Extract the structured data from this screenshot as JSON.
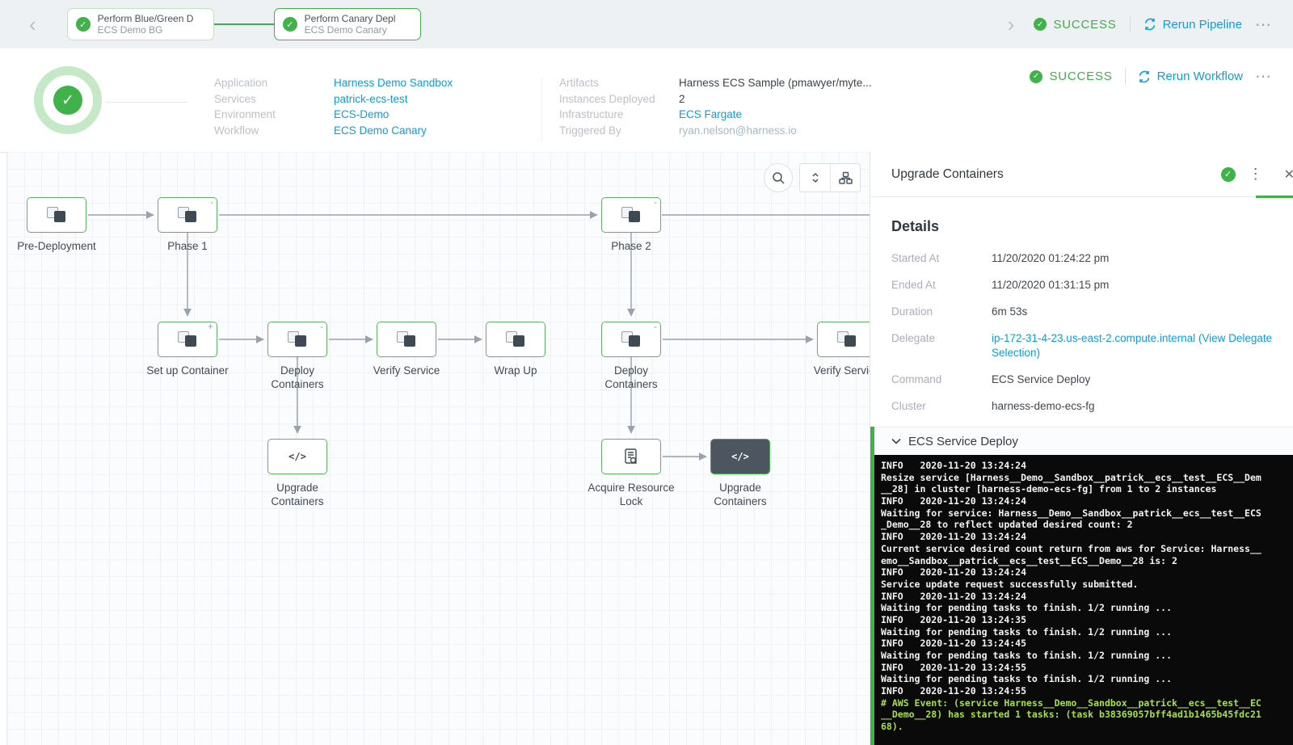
{
  "colors": {
    "accent_green": "#3fb24a",
    "link_blue": "#0a9fe0",
    "log_green": "#a8e03f"
  },
  "top_bar": {
    "stages": [
      {
        "title": "Perform Blue/Green D",
        "subtitle": "ECS Demo BG"
      },
      {
        "title": "Perform Canary Depl",
        "subtitle": "ECS Demo Canary"
      }
    ],
    "status": "SUCCESS",
    "rerun_label": "Rerun Pipeline"
  },
  "workflow_header": {
    "status": "SUCCESS",
    "rerun_label": "Rerun Workflow",
    "fields_left": [
      {
        "label": "Application",
        "value": "Harness Demo Sandbox",
        "style": "link"
      },
      {
        "label": "Services",
        "value": "patrick-ecs-test",
        "style": "link"
      },
      {
        "label": "Environment",
        "value": "ECS-Demo",
        "style": "link"
      },
      {
        "label": "Workflow",
        "value": "ECS Demo Canary",
        "style": "link"
      }
    ],
    "fields_right": [
      {
        "label": "Artifacts",
        "value": "Harness ECS Sample (pmawyer/myte...",
        "style": "plain"
      },
      {
        "label": "Instances Deployed",
        "value": "2",
        "style": "plain"
      },
      {
        "label": "Infrastructure",
        "value": "ECS Fargate",
        "style": "link"
      },
      {
        "label": "Triggered By",
        "value": "ryan.nelson@harness.io",
        "style": "muted-link"
      }
    ]
  },
  "canvas": {
    "nodes": [
      {
        "id": "pre-deployment",
        "label": "Pre-Deployment",
        "type": "squares"
      },
      {
        "id": "phase-1",
        "label": "Phase 1",
        "type": "squares",
        "badge": "-"
      },
      {
        "id": "phase-2",
        "label": "Phase 2",
        "type": "squares",
        "badge": "-"
      },
      {
        "id": "setup-container",
        "label": "Set up Container",
        "type": "squares",
        "badge": "+"
      },
      {
        "id": "deploy-containers-1",
        "label": "Deploy Containers",
        "type": "squares",
        "badge": "-"
      },
      {
        "id": "verify-service-1",
        "label": "Verify Service",
        "type": "squares"
      },
      {
        "id": "wrap-up",
        "label": "Wrap Up",
        "type": "squares"
      },
      {
        "id": "deploy-containers-2",
        "label": "Deploy Containers",
        "type": "squares",
        "badge": "-"
      },
      {
        "id": "verify-service-2",
        "label": "Verify Service",
        "type": "squares"
      },
      {
        "id": "upgrade-containers-1",
        "label": "Upgrade Containers",
        "type": "code"
      },
      {
        "id": "acquire-resource-lock",
        "label": "Acquire Resource Lock",
        "type": "doc"
      },
      {
        "id": "upgrade-containers-2",
        "label": "Upgrade Containers",
        "type": "code",
        "selected": true
      }
    ]
  },
  "panel": {
    "title": "Upgrade Containers",
    "details_title": "Details",
    "details": [
      {
        "label": "Started At",
        "value": "11/20/2020 01:24:22 pm",
        "style": "plain"
      },
      {
        "label": "Ended At",
        "value": "11/20/2020 01:31:15 pm",
        "style": "plain"
      },
      {
        "label": "Duration",
        "value": "6m 53s",
        "style": "plain"
      },
      {
        "label": "Delegate",
        "value": "ip-172-31-4-23.us-east-2.compute.internal  (View Delegate Selection)",
        "style": "link"
      },
      {
        "label": "Command",
        "value": "ECS Service Deploy",
        "style": "plain"
      },
      {
        "label": "Cluster",
        "value": "harness-demo-ecs-fg",
        "style": "plain"
      }
    ],
    "log_section_title": "ECS Service Deploy",
    "log_lines": [
      {
        "k": "info",
        "t": "INFO   2020-11-20 13:24:24"
      },
      {
        "k": "msg",
        "t": "Resize service [Harness__Demo__Sandbox__patrick__ecs__test__ECS__Dem"
      },
      {
        "k": "msg",
        "t": "__28] in cluster [harness-demo-ecs-fg] from 1 to 2 instances"
      },
      {
        "k": "info",
        "t": "INFO   2020-11-20 13:24:24"
      },
      {
        "k": "msg",
        "t": "Waiting for service: Harness__Demo__Sandbox__patrick__ecs__test__ECS"
      },
      {
        "k": "msg",
        "t": "_Demo__28 to reflect updated desired count: 2"
      },
      {
        "k": "info",
        "t": "INFO   2020-11-20 13:24:24"
      },
      {
        "k": "msg",
        "t": "Current service desired count return from aws for Service: Harness__"
      },
      {
        "k": "msg",
        "t": "emo__Sandbox__patrick__ecs__test__ECS__Demo__28 is: 2"
      },
      {
        "k": "info",
        "t": "INFO   2020-11-20 13:24:24"
      },
      {
        "k": "msg",
        "t": "Service update request successfully submitted."
      },
      {
        "k": "info",
        "t": "INFO   2020-11-20 13:24:24"
      },
      {
        "k": "msg",
        "t": "Waiting for pending tasks to finish. 1/2 running ..."
      },
      {
        "k": "info",
        "t": "INFO   2020-11-20 13:24:35"
      },
      {
        "k": "msg",
        "t": "Waiting for pending tasks to finish. 1/2 running ..."
      },
      {
        "k": "info",
        "t": "INFO   2020-11-20 13:24:45"
      },
      {
        "k": "msg",
        "t": "Waiting for pending tasks to finish. 1/2 running ..."
      },
      {
        "k": "info",
        "t": "INFO   2020-11-20 13:24:55"
      },
      {
        "k": "msg",
        "t": "Waiting for pending tasks to finish. 1/2 running ..."
      },
      {
        "k": "info",
        "t": "INFO   2020-11-20 13:24:55"
      },
      {
        "k": "aws",
        "t": "# AWS Event: (service Harness__Demo__Sandbox__patrick__ecs__test__EC"
      },
      {
        "k": "aws",
        "t": "__Demo__28) has started 1 tasks: (task b38369057bff4ad1b1465b45fdc21"
      },
      {
        "k": "aws",
        "t": "68)."
      }
    ]
  }
}
